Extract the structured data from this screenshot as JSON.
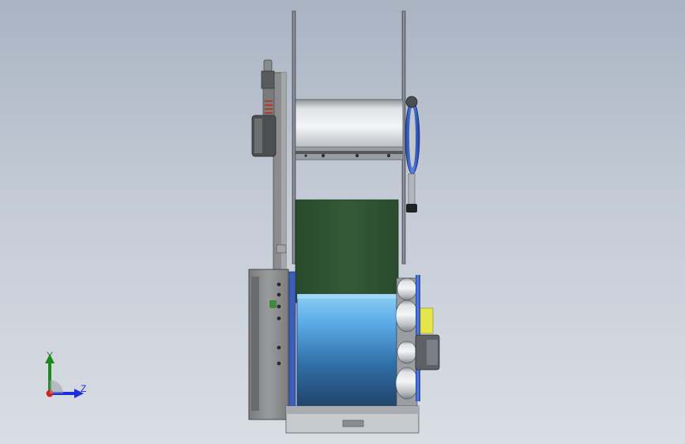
{
  "viewport": {
    "background_top": "#a9b3c2",
    "background_bottom": "#d9dde4"
  },
  "model": {
    "description_colors": {
      "belt": "#2f5233",
      "roller_blue": "#3f8fd8",
      "steel": "#c9cdd2",
      "frame_dark": "#6e6f70",
      "spring_red": "#b43a2a",
      "accent_yellow": "#e5e64a"
    }
  },
  "triad": {
    "y_label": "Y",
    "z_label": "Z",
    "y_color": "#1a8a1a",
    "z_color": "#1b2fd6",
    "x_color": "#d42020"
  }
}
